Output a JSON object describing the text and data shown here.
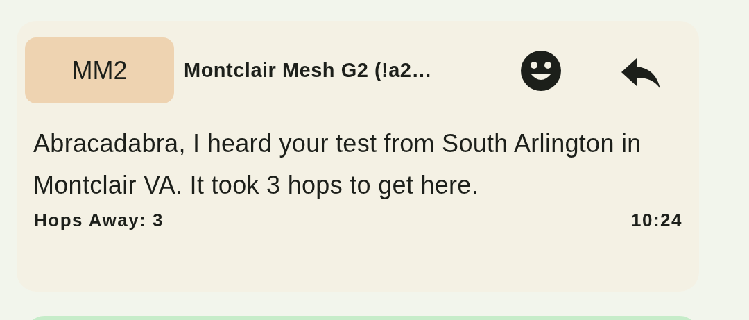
{
  "message": {
    "avatar": "MM2",
    "sender": "Montclair Mesh G2 (!a2…",
    "text": "Abracadabra, I heard your test from South Arlington in Montclair VA. It took 3 hops to get here.",
    "hops": "Hops Away: 3",
    "time": "10:24"
  }
}
